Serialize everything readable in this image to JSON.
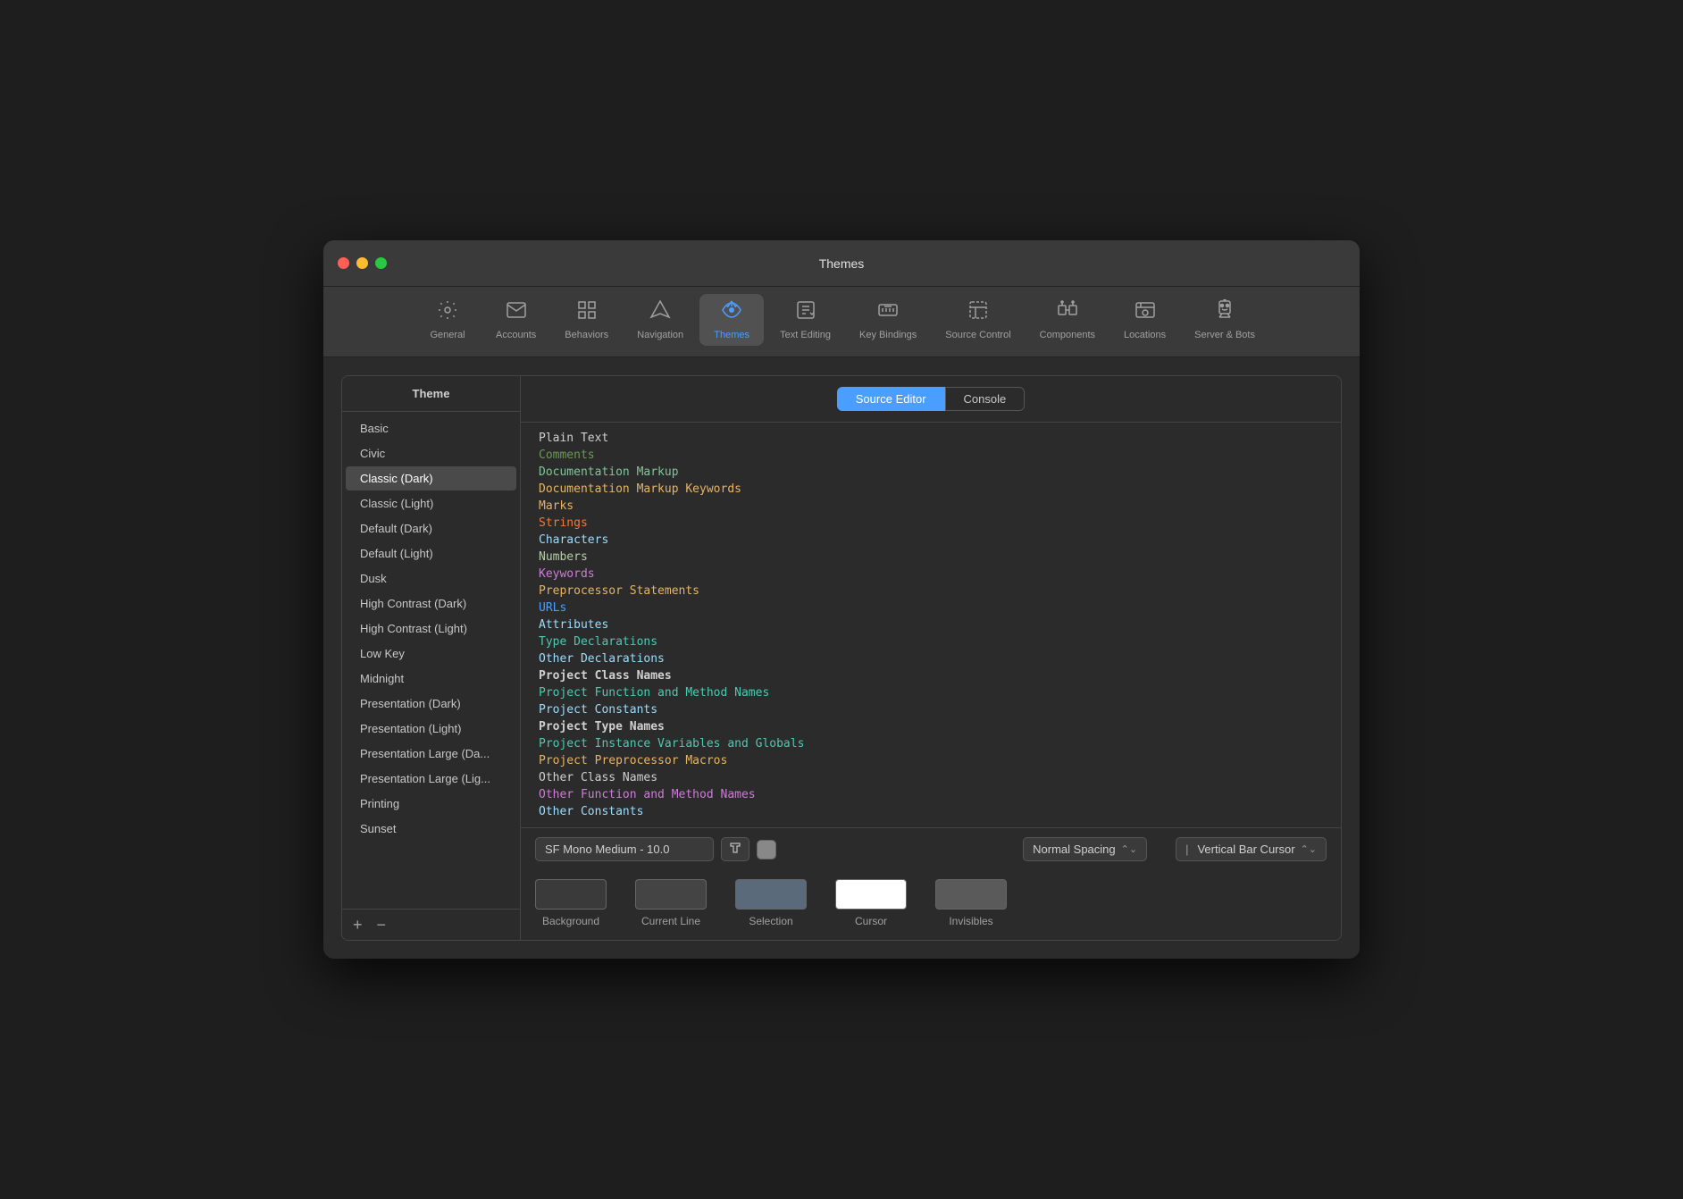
{
  "window": {
    "title": "Themes"
  },
  "toolbar": {
    "items": [
      {
        "id": "general",
        "label": "General",
        "icon": "⚙️"
      },
      {
        "id": "accounts",
        "label": "Accounts",
        "icon": "✉️"
      },
      {
        "id": "behaviors",
        "label": "Behaviors",
        "icon": "⊞"
      },
      {
        "id": "navigation",
        "label": "Navigation",
        "icon": "◇"
      },
      {
        "id": "themes",
        "label": "Themes",
        "icon": "🖊"
      },
      {
        "id": "text-editing",
        "label": "Text Editing",
        "icon": "⌨"
      },
      {
        "id": "key-bindings",
        "label": "Key Bindings",
        "icon": "⌨"
      },
      {
        "id": "source-control",
        "label": "Source Control",
        "icon": "⊠"
      },
      {
        "id": "components",
        "label": "Components",
        "icon": "🧩"
      },
      {
        "id": "locations",
        "label": "Locations",
        "icon": "🖥"
      },
      {
        "id": "server-bots",
        "label": "Server & Bots",
        "icon": "🤖"
      }
    ]
  },
  "sidebar": {
    "header": "Theme",
    "themes": [
      {
        "id": "basic",
        "label": "Basic",
        "selected": false
      },
      {
        "id": "civic",
        "label": "Civic",
        "selected": false
      },
      {
        "id": "classic-dark",
        "label": "Classic (Dark)",
        "selected": true
      },
      {
        "id": "classic-light",
        "label": "Classic (Light)",
        "selected": false
      },
      {
        "id": "default-dark",
        "label": "Default (Dark)",
        "selected": false
      },
      {
        "id": "default-light",
        "label": "Default (Light)",
        "selected": false
      },
      {
        "id": "dusk",
        "label": "Dusk",
        "selected": false
      },
      {
        "id": "high-contrast-dark",
        "label": "High Contrast (Dark)",
        "selected": false
      },
      {
        "id": "high-contrast-light",
        "label": "High Contrast (Light)",
        "selected": false
      },
      {
        "id": "low-key",
        "label": "Low Key",
        "selected": false
      },
      {
        "id": "midnight",
        "label": "Midnight",
        "selected": false
      },
      {
        "id": "presentation-dark",
        "label": "Presentation (Dark)",
        "selected": false
      },
      {
        "id": "presentation-light",
        "label": "Presentation (Light)",
        "selected": false
      },
      {
        "id": "presentation-large-dark",
        "label": "Presentation Large (Da...",
        "selected": false
      },
      {
        "id": "presentation-large-light",
        "label": "Presentation Large (Lig...",
        "selected": false
      },
      {
        "id": "printing",
        "label": "Printing",
        "selected": false
      },
      {
        "id": "sunset",
        "label": "Sunset",
        "selected": false
      }
    ],
    "add_btn": "+",
    "remove_btn": "−"
  },
  "tabs": {
    "source_editor": "Source Editor",
    "console": "Console"
  },
  "syntax_items": [
    {
      "label": "Plain Text",
      "color": "#d0d0d0"
    },
    {
      "label": "Comments",
      "color": "#6a9955"
    },
    {
      "label": "Documentation Markup",
      "color": "#7ec699"
    },
    {
      "label": "Documentation Markup Keywords",
      "color": "#e5b567"
    },
    {
      "label": "Marks",
      "color": "#e5b567"
    },
    {
      "label": "Strings",
      "color": "#e87d3e"
    },
    {
      "label": "Characters",
      "color": "#9cdcfe"
    },
    {
      "label": "Numbers",
      "color": "#b5cea8"
    },
    {
      "label": "Keywords",
      "color": "#cc7dd5"
    },
    {
      "label": "Preprocessor Statements",
      "color": "#e5b567"
    },
    {
      "label": "URLs",
      "color": "#4a9eff"
    },
    {
      "label": "Attributes",
      "color": "#9cdcfe"
    },
    {
      "label": "Type Declarations",
      "color": "#4ec9b0"
    },
    {
      "label": "Other Declarations",
      "color": "#9cdcfe"
    },
    {
      "label": "Project Class Names",
      "color": "#d0d0d0",
      "bold": true
    },
    {
      "label": "Project Function and Method Names",
      "color": "#4ec9b0"
    },
    {
      "label": "Project Constants",
      "color": "#9cdcfe"
    },
    {
      "label": "Project Type Names",
      "color": "#d0d0d0",
      "bold": true
    },
    {
      "label": "Project Instance Variables and Globals",
      "color": "#4ec9b0"
    },
    {
      "label": "Project Preprocessor Macros",
      "color": "#e5b567"
    },
    {
      "label": "Other Class Names",
      "color": "#d0d0d0"
    },
    {
      "label": "Other Function and Method Names",
      "color": "#cc7dd5"
    },
    {
      "label": "Other Constants",
      "color": "#9cdcfe"
    }
  ],
  "font_controls": {
    "font_name": "SF Mono Medium - 10.0",
    "spacing_label": "Normal Spacing",
    "cursor_label": "Vertical Bar Cursor"
  },
  "color_swatches": [
    {
      "id": "background",
      "label": "Background",
      "color": "#3a3a3a"
    },
    {
      "id": "current-line",
      "label": "Current Line",
      "color": "#444444"
    },
    {
      "id": "selection",
      "label": "Selection",
      "color": "#5a6a7a"
    },
    {
      "id": "cursor",
      "label": "Cursor",
      "color": "#ffffff"
    },
    {
      "id": "invisibles",
      "label": "Invisibles",
      "color": "#5a5a5a"
    }
  ]
}
